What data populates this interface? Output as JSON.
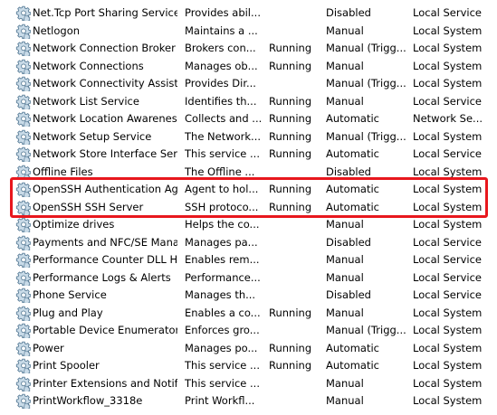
{
  "colors": {
    "highlight_border": "#e8171d",
    "gear_light": "#c9dbe8",
    "gear_dark": "#5c7f99"
  },
  "icon_name": "service-gear-icon",
  "services": [
    {
      "name": "Net.Tcp Port Sharing Service",
      "description": "Provides abil...",
      "status": "",
      "startup_type": "Disabled",
      "log_on_as": "Local Service"
    },
    {
      "name": "Netlogon",
      "description": "Maintains a ...",
      "status": "",
      "startup_type": "Manual",
      "log_on_as": "Local System"
    },
    {
      "name": "Network Connection Broker",
      "description": "Brokers con...",
      "status": "Running",
      "startup_type": "Manual (Trigg...",
      "log_on_as": "Local System"
    },
    {
      "name": "Network Connections",
      "description": "Manages ob...",
      "status": "Running",
      "startup_type": "Manual",
      "log_on_as": "Local System"
    },
    {
      "name": "Network Connectivity Assist...",
      "description": "Provides Dir...",
      "status": "",
      "startup_type": "Manual (Trigg...",
      "log_on_as": "Local System"
    },
    {
      "name": "Network List Service",
      "description": "Identifies th...",
      "status": "Running",
      "startup_type": "Manual",
      "log_on_as": "Local Service"
    },
    {
      "name": "Network Location Awareness",
      "description": "Collects and ...",
      "status": "Running",
      "startup_type": "Automatic",
      "log_on_as": "Network Se..."
    },
    {
      "name": "Network Setup Service",
      "description": "The Network...",
      "status": "Running",
      "startup_type": "Manual (Trigg...",
      "log_on_as": "Local System"
    },
    {
      "name": "Network Store Interface Serv...",
      "description": "This service ...",
      "status": "Running",
      "startup_type": "Automatic",
      "log_on_as": "Local Service"
    },
    {
      "name": "Offline Files",
      "description": "The Offline ...",
      "status": "",
      "startup_type": "Disabled",
      "log_on_as": "Local System"
    },
    {
      "name": "OpenSSH Authentication Ag...",
      "description": "Agent to hol...",
      "status": "Running",
      "startup_type": "Automatic",
      "log_on_as": "Local System"
    },
    {
      "name": "OpenSSH SSH Server",
      "description": "SSH protoco...",
      "status": "Running",
      "startup_type": "Automatic",
      "log_on_as": "Local System"
    },
    {
      "name": "Optimize drives",
      "description": "Helps the co...",
      "status": "",
      "startup_type": "Manual",
      "log_on_as": "Local System"
    },
    {
      "name": "Payments and NFC/SE Mana...",
      "description": "Manages pa...",
      "status": "",
      "startup_type": "Disabled",
      "log_on_as": "Local Service"
    },
    {
      "name": "Performance Counter DLL H...",
      "description": "Enables rem...",
      "status": "",
      "startup_type": "Manual",
      "log_on_as": "Local Service"
    },
    {
      "name": "Performance Logs & Alerts",
      "description": "Performance...",
      "status": "",
      "startup_type": "Manual",
      "log_on_as": "Local Service"
    },
    {
      "name": "Phone Service",
      "description": "Manages th...",
      "status": "",
      "startup_type": "Disabled",
      "log_on_as": "Local Service"
    },
    {
      "name": "Plug and Play",
      "description": "Enables a co...",
      "status": "Running",
      "startup_type": "Manual",
      "log_on_as": "Local System"
    },
    {
      "name": "Portable Device Enumerator ...",
      "description": "Enforces gro...",
      "status": "",
      "startup_type": "Manual (Trigg...",
      "log_on_as": "Local System"
    },
    {
      "name": "Power",
      "description": "Manages po...",
      "status": "Running",
      "startup_type": "Automatic",
      "log_on_as": "Local System"
    },
    {
      "name": "Print Spooler",
      "description": "This service ...",
      "status": "Running",
      "startup_type": "Automatic",
      "log_on_as": "Local System"
    },
    {
      "name": "Printer Extensions and Notifi...",
      "description": "This service ...",
      "status": "",
      "startup_type": "Manual",
      "log_on_as": "Local System"
    },
    {
      "name": "PrintWorkflow_3318e",
      "description": "Print Workfl...",
      "status": "",
      "startup_type": "Manual",
      "log_on_as": "Local System"
    }
  ],
  "highlighted_services": [
    "OpenSSH Authentication Ag...",
    "OpenSSH SSH Server"
  ]
}
